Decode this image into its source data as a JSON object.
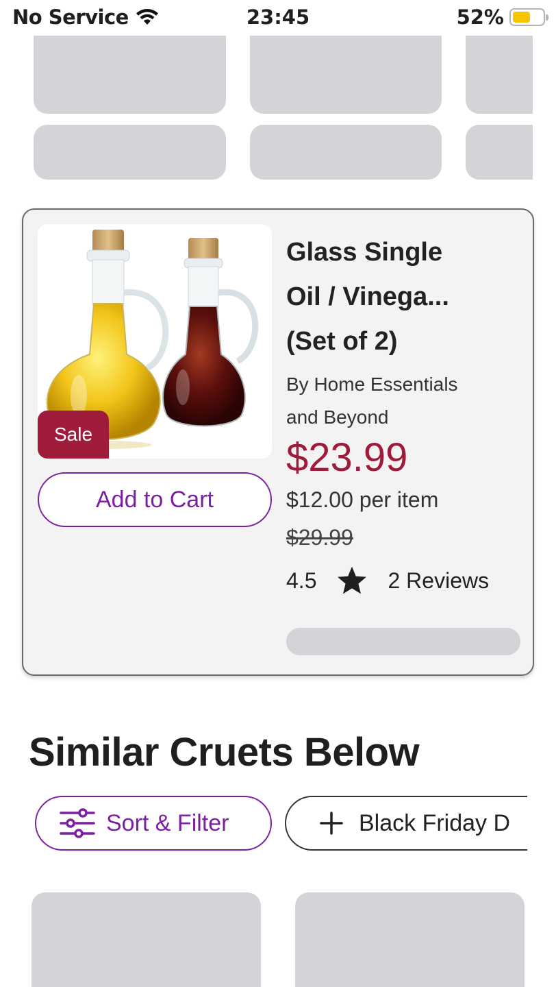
{
  "status_bar": {
    "carrier": "No Service",
    "time": "23:45",
    "battery": "52%",
    "battery_level": 0.52,
    "battery_color": "#f6c500"
  },
  "product": {
    "title_line1": "Glass Single",
    "title_line2": "Oil / Vinega...",
    "title_line3": "(Set of 2)",
    "brand_line1": "By Home Essentials",
    "brand_line2": "and Beyond",
    "sale_badge": "Sale",
    "price": "$23.99",
    "price_color": "#9e1b3a",
    "per_item": "$12.00 per item",
    "original_price": "$29.99",
    "rating": "4.5",
    "reviews": "2 Reviews",
    "add_to_cart": "Add to Cart",
    "image_icon": "oil-vinegar-cruets-image"
  },
  "section": {
    "title": "Similar Cruets Below"
  },
  "chips": {
    "sort_filter": "Sort & Filter",
    "black_friday": "Black Friday D",
    "accent_color": "#7d1fa2"
  }
}
